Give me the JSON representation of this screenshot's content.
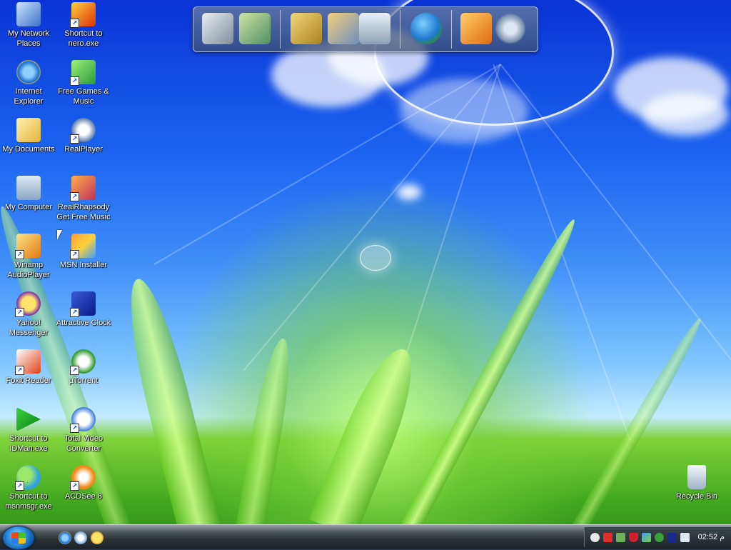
{
  "desktop": {
    "icons": [
      {
        "label": "My Network Places",
        "icon": "network-places-icon"
      },
      {
        "label": "Shortcut to nero.exe",
        "icon": "nero-flame-icon"
      },
      {
        "label": "Internet Explorer",
        "icon": "internet-explorer-icon"
      },
      {
        "label": "Free Games & Music",
        "icon": "gift-box-icon"
      },
      {
        "label": "My Documents",
        "icon": "documents-folder-icon"
      },
      {
        "label": "RealPlayer",
        "icon": "realplayer-icon"
      },
      {
        "label": "My Computer",
        "icon": "computer-icon"
      },
      {
        "label": "RealRhapsody Get Free Music",
        "icon": "rhapsody-icon"
      },
      {
        "label": "Winamp AudioPlayer",
        "icon": "winamp-icon"
      },
      {
        "label": "MSN Installer",
        "icon": "msn-butterfly-icon"
      },
      {
        "label": "Yahoo! Messenger",
        "icon": "yahoo-messenger-icon"
      },
      {
        "label": "Attractive Clock",
        "icon": "clock-icon"
      },
      {
        "label": "Foxit Reader",
        "icon": "foxit-reader-icon"
      },
      {
        "label": "µTorrent",
        "icon": "utorrent-icon"
      },
      {
        "label": "Shortcut to IDMan.exe",
        "icon": "idm-arrow-icon"
      },
      {
        "label": "Total Video Converter",
        "icon": "video-converter-icon"
      },
      {
        "label": "Shortcut to msnmsgr.exe",
        "icon": "msn-messenger-icon"
      },
      {
        "label": "ACDSee 8",
        "icon": "acdsee-icon"
      }
    ],
    "recycle_bin": {
      "label": "Recycle Bin",
      "icon": "recycle-bin-icon"
    }
  },
  "dock": {
    "items": [
      "hard-drive-icon",
      "documents-folder-icon",
      "folder-icon",
      "pictures-icon",
      "trash-icon",
      "globe-icon",
      "media-player-icon",
      "settings-gear-icon"
    ]
  },
  "taskbar": {
    "start_icon": "windows-logo-icon",
    "quick_launch": [
      "internet-explorer-icon",
      "msn-messenger-icon",
      "yahoo-messenger-icon"
    ],
    "tray_icons": [
      "yahoo-tray-icon",
      "antivirus-tray-icon",
      "network-tray-icon",
      "security-shield-icon",
      "msn-tray-icon",
      "torrent-tray-icon",
      "language-tray-icon",
      "device-tray-icon"
    ],
    "clock": "02:52 م"
  },
  "colors": {
    "sky": "#1b64f0",
    "grass": "#3fa51e",
    "taskbar": "#2b3236"
  }
}
